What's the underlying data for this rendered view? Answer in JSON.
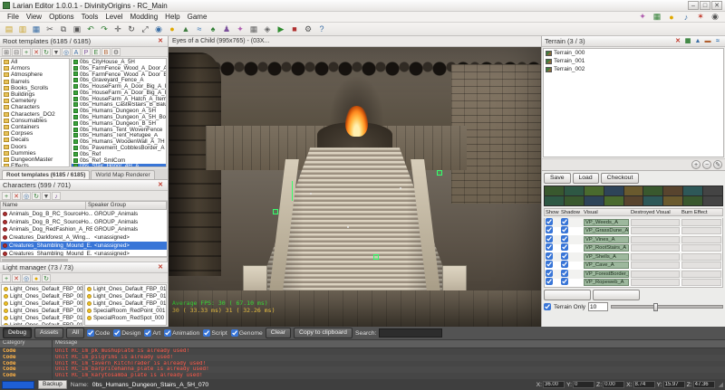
{
  "window": {
    "title": "Larian Editor 1.0.0.1 - DivinityOrigins - RC_Main",
    "menu": [
      "File",
      "View",
      "Options",
      "Tools",
      "Level",
      "Modding",
      "Help",
      "Game"
    ],
    "controls": [
      "–",
      "□",
      "✕"
    ]
  },
  "menubar_icons": [
    {
      "name": "story-icon",
      "glyph": "✦",
      "color": "#b05fb0"
    },
    {
      "name": "ai-grid-icon",
      "glyph": "▦",
      "color": "#2e7d32"
    },
    {
      "name": "light-icon",
      "glyph": "●",
      "color": "#e0a800"
    },
    {
      "name": "sound-icon",
      "glyph": "♪",
      "color": "#3a6ea5"
    },
    {
      "name": "fx-icon",
      "glyph": "✶",
      "color": "#c0392b"
    },
    {
      "name": "camera-icon",
      "glyph": "◉",
      "color": "#555555"
    }
  ],
  "toolbar": {
    "icons": [
      {
        "name": "new-icon",
        "glyph": "▤",
        "color": "#c9a227"
      },
      {
        "name": "open-icon",
        "glyph": "▥",
        "color": "#c9a227"
      },
      {
        "name": "save-icon",
        "glyph": "▦",
        "color": "#3a6ea5"
      },
      {
        "name": "cut-icon",
        "glyph": "✂",
        "color": "#555555"
      },
      {
        "name": "copy-icon",
        "glyph": "⧉",
        "color": "#555555"
      },
      {
        "name": "paste-icon",
        "glyph": "▣",
        "color": "#555555"
      },
      {
        "name": "undo-icon",
        "glyph": "↶",
        "color": "#2e7d32"
      },
      {
        "name": "redo-icon",
        "glyph": "↷",
        "color": "#2e7d32"
      },
      {
        "name": "move-icon",
        "glyph": "✛",
        "color": "#444444"
      },
      {
        "name": "rotate-icon",
        "glyph": "↻",
        "color": "#444444"
      },
      {
        "name": "scale-icon",
        "glyph": "⤢",
        "color": "#444444"
      },
      {
        "name": "camera-icon",
        "glyph": "◉",
        "color": "#3a6ea5"
      },
      {
        "name": "light-icon",
        "glyph": "●",
        "color": "#e0a800"
      },
      {
        "name": "terrain-icon",
        "glyph": "▲",
        "color": "#3f7d3f"
      },
      {
        "name": "water-icon",
        "glyph": "≈",
        "color": "#2f6fb0"
      },
      {
        "name": "vegetation-icon",
        "glyph": "♠",
        "color": "#2e7d32"
      },
      {
        "name": "character-icon",
        "glyph": "♟",
        "color": "#7a4f9a"
      },
      {
        "name": "effect-icon",
        "glyph": "✦",
        "color": "#b05fb0"
      },
      {
        "name": "grid-icon",
        "glyph": "▦",
        "color": "#666666"
      },
      {
        "name": "snap-icon",
        "glyph": "◈",
        "color": "#666666"
      },
      {
        "name": "play-icon",
        "glyph": "▶",
        "color": "#2e8b2e"
      },
      {
        "name": "stop-icon",
        "glyph": "■",
        "color": "#b03030"
      },
      {
        "name": "settings-icon",
        "glyph": "⚙",
        "color": "#555555"
      },
      {
        "name": "help-icon",
        "glyph": "?",
        "color": "#3a6ea5"
      }
    ]
  },
  "root_templates": {
    "title": "Root templates (6185 / 6185)",
    "header_icons": [
      {
        "name": "close-panel-icon",
        "glyph": "✕",
        "color": "#c0392b"
      }
    ],
    "toolbar_icons": [
      {
        "name": "expand-all-icon",
        "glyph": "⊞",
        "color": "#555555"
      },
      {
        "name": "collapse-all-icon",
        "glyph": "⊟",
        "color": "#555555"
      },
      {
        "name": "add-template-icon",
        "glyph": "+",
        "color": "#2e7d32"
      },
      {
        "name": "delete-template-icon",
        "glyph": "✕",
        "color": "#c0392b"
      },
      {
        "name": "refresh-icon",
        "glyph": "↻",
        "color": "#2e7d32"
      },
      {
        "name": "filter-icon",
        "glyph": "▼",
        "color": "#555555"
      },
      {
        "name": "locate-icon",
        "glyph": "◎",
        "color": "#3a6ea5"
      },
      {
        "name": "tag-a-icon",
        "glyph": "A",
        "color": "#3a6ea5"
      },
      {
        "name": "tag-p-icon",
        "glyph": "P",
        "color": "#7a4f9a"
      },
      {
        "name": "tag-e-icon",
        "glyph": "E",
        "color": "#2e7d32"
      },
      {
        "name": "tag-b-icon",
        "glyph": "B",
        "color": "#b05f2e"
      },
      {
        "name": "settings-icon",
        "glyph": "⚙",
        "color": "#555555"
      }
    ],
    "tree": [
      "All",
      "Armors",
      "Atmosphere",
      "Barrels",
      "Books_Scrolls",
      "Buildings",
      "Cemetery",
      "Characters",
      "Characters_DO2",
      "Consumables",
      "Containers",
      "Corpses",
      "Decals",
      "Doors",
      "Dummies",
      "DungeonMaster",
      "Effects"
    ],
    "items": [
      {
        "label": "0bs_CityHouse_A_5H"
      },
      {
        "label": "0bs_FarmFence_Wood_A_Door_A_B_Item"
      },
      {
        "label": "0bs_FarmFence_Wood_A_Door_E_A_Item"
      },
      {
        "label": "0bs_Graveyard_Fence_A"
      },
      {
        "label": "0bs_HouseFarm_A_Door_Big_A_Item"
      },
      {
        "label": "0bs_HouseFarm_A_Door_Big_A_Item_Destruct"
      },
      {
        "label": "0bs_HouseFarm_A_Hatch_A_Item"
      },
      {
        "label": "0bs_Humans_CastleStairs_B_Balustrade_A"
      },
      {
        "label": "0bs_Humans_Dungeon_A_5H"
      },
      {
        "label": "0bs_Humans_Dungeon_A_5H_Border_A"
      },
      {
        "label": "0bs_Humans_Dungeon_B_5H"
      },
      {
        "label": "0bs_Humans_Tent_WovenFence"
      },
      {
        "label": "0bs_Humans_Tent_Refugee_A"
      },
      {
        "label": "0bs_Humans_WoodenWall_A_7H"
      },
      {
        "label": "0bs_Pavement_CobblesBorder_A"
      },
      {
        "label": "0bs_Ref"
      },
      {
        "label": "0bs_Ref_SmlCom"
      },
      {
        "label": "0bs_Stair_Honor_4H_A",
        "selected": true
      }
    ]
  },
  "tabs": {
    "left": "Root templates (6185 / 6185)",
    "right": "World Map Renderer"
  },
  "characters": {
    "title": "Characters (599 / 701)",
    "header_icons": [
      {
        "name": "close-panel-icon",
        "glyph": "✕",
        "color": "#c0392b"
      }
    ],
    "toolbar_icons": [
      {
        "name": "add-character-icon",
        "glyph": "+",
        "color": "#2e7d32"
      },
      {
        "name": "delete-character-icon",
        "glyph": "✕",
        "color": "#c0392b"
      },
      {
        "name": "goto-character-icon",
        "glyph": "◎",
        "color": "#3a6ea5"
      },
      {
        "name": "refresh-icon",
        "glyph": "↻",
        "color": "#2e7d32"
      },
      {
        "name": "filter-icon",
        "glyph": "▼",
        "color": "#555555"
      },
      {
        "name": "speaker-icon",
        "glyph": "♪",
        "color": "#7a4f9a"
      }
    ],
    "columns": [
      "Name",
      "Speaker Group"
    ],
    "rows": [
      {
        "name": "Animals_Dog_B_RC_SourceHo...",
        "group": "GROUP_Animals"
      },
      {
        "name": "Animals_Dog_B_RC_SourceHo...",
        "group": "GROUP_Animals"
      },
      {
        "name": "Animals_Dog_RedFashion_A_RB",
        "group": "GROUP_Animals"
      },
      {
        "name": "Creatures_Darkforest_A_Wing...",
        "group": "<unassigned>"
      },
      {
        "name": "Creatures_Shambling_Mound_E...",
        "group": "<unassigned>",
        "selected": true
      },
      {
        "name": "Creatures_Shambling_Mound_E...",
        "group": "<unassigned>"
      }
    ]
  },
  "lights": {
    "title": "Light manager (73 / 73)",
    "header_icons": [
      {
        "name": "close-panel-icon",
        "glyph": "✕",
        "color": "#c0392b"
      }
    ],
    "toolbar_icons": [
      {
        "name": "add-light-icon",
        "glyph": "+",
        "color": "#2e7d32"
      },
      {
        "name": "delete-light-icon",
        "glyph": "✕",
        "color": "#c0392b"
      },
      {
        "name": "goto-light-icon",
        "glyph": "◎",
        "color": "#3a6ea5"
      },
      {
        "name": "toggle-light-icon",
        "glyph": "●",
        "color": "#e0a800"
      },
      {
        "name": "refresh-icon",
        "glyph": "↻",
        "color": "#2e7d32"
      }
    ],
    "left": [
      "Light_Ones_Default_FBP_006",
      "Light_Ones_Default_FBP_007",
      "Light_Ones_Default_FBP_008",
      "Light_Ones_Default_FBP_009",
      "Light_Ones_Default_FBP_010",
      "Light_Ones_Default_FBP_011"
    ],
    "right": [
      "Light_Ones_Default_FBP_012",
      "Light_Ones_Default_FBP_013",
      "Light_Ones_Default_FBP_014",
      "SpecialRoom_RedPoint_001",
      "SpecialRoom_RedSpot_000"
    ]
  },
  "viewport": {
    "caption": "Eyes of a Child (995x765) - (03X...",
    "stats_line1": "Average FPS:   30 ( 67.10 ms)",
    "stats_line2": "30 ( 33.33 ms)   31 ( 32.26 ms)"
  },
  "terrain": {
    "title": "Terrain (3 / 3)",
    "header_icons": [
      {
        "name": "delete-terrain-icon",
        "glyph": "✕",
        "color": "#c0392b"
      },
      {
        "name": "paint-terrain-icon",
        "glyph": "▦",
        "color": "#2e7d32"
      },
      {
        "name": "raise-terrain-icon",
        "glyph": "▲",
        "color": "#3a6ea5"
      },
      {
        "name": "flatten-terrain-icon",
        "glyph": "▬",
        "color": "#b05f2e"
      },
      {
        "name": "water-terrain-icon",
        "glyph": "≈",
        "color": "#2f6fb0"
      }
    ],
    "items": [
      {
        "label": "Terrain_000"
      },
      {
        "label": "Terrain_001"
      },
      {
        "label": "Terrain_002"
      }
    ],
    "footer_icons": [
      {
        "name": "add-terrain-icon",
        "glyph": "+"
      },
      {
        "name": "remove-terrain-icon",
        "glyph": "−"
      },
      {
        "name": "edit-terrain-icon",
        "glyph": "✎"
      }
    ]
  },
  "props": {
    "buttons": [
      "Save",
      "Load",
      "Checkout"
    ],
    "swatches": [
      "#39582e",
      "#2e5844",
      "#4a6a2e",
      "#2e4458",
      "#6a5a2e",
      "#39582e",
      "#58442e",
      "#2e5858",
      "#444444",
      "#2e5844",
      "#39582e",
      "#2e4458",
      "#4a6a2e",
      "#58442e",
      "#2e5858",
      "#6a5a2e",
      "#39582e",
      "#444444"
    ],
    "columns": [
      "Show",
      "Shadow",
      "Visual",
      "Destroyed Visual",
      "Burn Effect"
    ],
    "rows": [
      {
        "show": true,
        "shadow": true,
        "visual": "VP_Weeds_A"
      },
      {
        "show": true,
        "shadow": true,
        "visual": "VP_GrassDune_A"
      },
      {
        "show": true,
        "shadow": true,
        "visual": "VP_Vines_A"
      },
      {
        "show": true,
        "shadow": true,
        "visual": "VP_RootStairs_A"
      },
      {
        "show": true,
        "shadow": true,
        "visual": "VP_Shells_A"
      },
      {
        "show": true,
        "shadow": true,
        "visual": "VP_Cave_A"
      },
      {
        "show": true,
        "shadow": true,
        "visual": "VP_ForestBorder_B"
      },
      {
        "show": true,
        "shadow": true,
        "visual": "VP_Ropeweb_A"
      }
    ],
    "action_buttons": [
      "",
      ""
    ],
    "terrain_only_label": "Terrain Only",
    "value": "10"
  },
  "console": {
    "tabs": [
      {
        "label": "Debug",
        "active": true
      },
      {
        "label": "Assets"
      }
    ],
    "all_label": "All",
    "filters": [
      {
        "label": "Code",
        "checked": true
      },
      {
        "label": "Design",
        "checked": true
      },
      {
        "label": "Art",
        "checked": true
      },
      {
        "label": "Animation",
        "checked": true
      },
      {
        "label": "Script",
        "checked": true
      },
      {
        "label": "Genome",
        "checked": true
      }
    ],
    "buttons": [
      "Clear",
      "Copy to clipboard"
    ],
    "search_label": "Search:",
    "columns": [
      "Category",
      "Message"
    ],
    "rows": [
      {
        "category": "Code",
        "message": "Unit RC_im_pk_mushuplate is already used!"
      },
      {
        "category": "Code",
        "message": "Unit RC_im_pilgrims is already used!"
      },
      {
        "category": "Code",
        "message": "Unit RC_im_tavern_KitchTrader is already used!"
      },
      {
        "category": "Code",
        "message": "Unit RC_im_barpricehanna_plate is already used!"
      },
      {
        "category": "Code",
        "message": "Unit RC_im_karytosamba_plate is already used!"
      }
    ]
  },
  "statusbar": {
    "backup": "Backup",
    "name_label": "Name:",
    "name_value": "0bs_Humans_Dungeon_Stairs_A_5H_070",
    "coords": [
      {
        "label": "X:",
        "value": "36.00"
      },
      {
        "label": "Y:",
        "value": "0"
      },
      {
        "label": "Z:",
        "value": "0.00"
      },
      {
        "label": "X:",
        "value": "8.74"
      },
      {
        "label": "Y:",
        "value": "15.97"
      },
      {
        "label": "Z:",
        "value": "47.36"
      }
    ]
  }
}
